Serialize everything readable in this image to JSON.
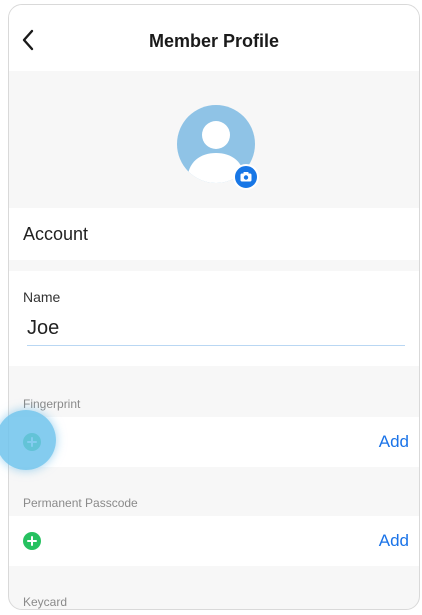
{
  "header": {
    "title": "Member Profile"
  },
  "icons": {
    "back": "chevron-left-icon",
    "avatar": "user-silhouette-icon",
    "camera": "camera-icon",
    "add": "plus-circle-icon"
  },
  "account": {
    "label": "Account"
  },
  "name_field": {
    "label": "Name",
    "value": "Joe"
  },
  "fingerprint": {
    "section_label": "Fingerprint",
    "action_label": "Add"
  },
  "passcode": {
    "section_label": "Permanent Passcode",
    "action_label": "Add"
  },
  "keycard": {
    "section_label": "Keycard"
  },
  "colors": {
    "accent_blue": "#1a73e8",
    "add_green": "#26c160",
    "avatar_bg": "#8fc3e6",
    "touch_highlight": "#6ec3ec"
  }
}
